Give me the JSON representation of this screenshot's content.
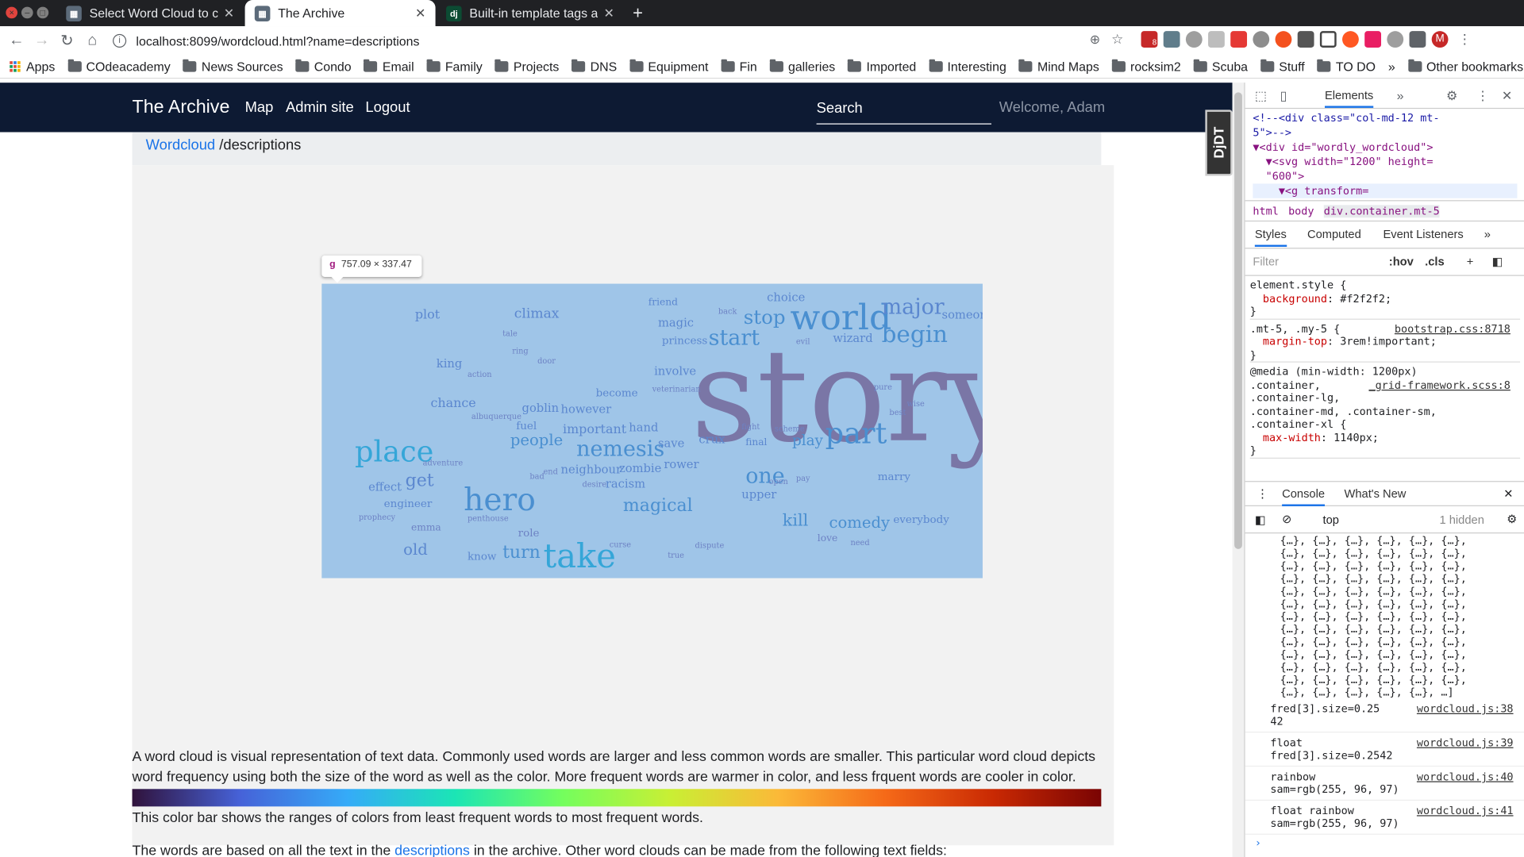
{
  "browser": {
    "tabs": [
      {
        "title": "Select Word Cloud to cha",
        "active": false
      },
      {
        "title": "The Archive",
        "active": true
      },
      {
        "title": "Built-in template tags an",
        "active": false
      }
    ],
    "url": "localhost:8099/wordcloud.html?name=descriptions",
    "bookmarks": [
      "Apps",
      "COdeacademy",
      "News Sources",
      "Condo",
      "Email",
      "Family",
      "Projects",
      "DNS",
      "Equipment",
      "Fin",
      "galleries",
      "Imported",
      "Interesting",
      "Mind Maps",
      "rocksim2",
      "Scuba",
      "Stuff",
      "TO DO"
    ],
    "other_bookmarks": "Other bookmarks",
    "more_bookmarks": "»",
    "profile_initial": "M",
    "extension_badge": "8"
  },
  "site": {
    "brand": "The Archive",
    "nav": [
      "Map",
      "Admin site",
      "Logout"
    ],
    "search_placeholder": "Search",
    "welcome": "Welcome, Adam",
    "djdt": "DjDT"
  },
  "breadcrumb": {
    "link": "Wordcloud",
    "rest": " /descriptions"
  },
  "inspector_tooltip": {
    "tag": "g",
    "size": "757.09 × 337.47"
  },
  "cloud_words": [
    {
      "t": "story",
      "c": "#7a76a6"
    },
    {
      "t": "world",
      "c": "#4a8fd0"
    },
    {
      "t": "hero",
      "c": "#4a8fd0"
    },
    {
      "t": "take",
      "c": "#35a6d8"
    },
    {
      "t": "place",
      "c": "#35a6d8"
    },
    {
      "t": "nemesis",
      "c": "#4a8fd0"
    },
    {
      "t": "part",
      "c": "#4a8fd0"
    },
    {
      "t": "major",
      "c": "#5b87cf"
    },
    {
      "t": "begin",
      "c": "#4a8fd0"
    },
    {
      "t": "start",
      "c": "#4a8fd0"
    },
    {
      "t": "stop",
      "c": "#4a8fd0"
    },
    {
      "t": "one",
      "c": "#4a8fd0"
    },
    {
      "t": "magical",
      "c": "#4a8fd0"
    },
    {
      "t": "turn",
      "c": "#4a8fd0"
    },
    {
      "t": "people",
      "c": "#4a8fd0"
    },
    {
      "t": "comedy",
      "c": "#4a8fd0"
    },
    {
      "t": "kill",
      "c": "#4a8fd0"
    },
    {
      "t": "play",
      "c": "#4a8fd0"
    },
    {
      "t": "get",
      "c": "#5b87cf"
    },
    {
      "t": "old",
      "c": "#5b87cf"
    },
    {
      "t": "climax",
      "c": "#5b87cf"
    },
    {
      "t": "plot",
      "c": "#5b87cf"
    },
    {
      "t": "someone",
      "c": "#5b87cf"
    },
    {
      "t": "wizard",
      "c": "#5b87cf"
    },
    {
      "t": "choice",
      "c": "#5b87cf"
    },
    {
      "t": "magic",
      "c": "#5b87cf"
    },
    {
      "t": "princess",
      "c": "#5b87cf"
    },
    {
      "t": "friend",
      "c": "#5b87cf"
    },
    {
      "t": "king",
      "c": "#5b87cf"
    },
    {
      "t": "chance",
      "c": "#5b87cf"
    },
    {
      "t": "goblin",
      "c": "#5b87cf"
    },
    {
      "t": "however",
      "c": "#5b87cf"
    },
    {
      "t": "become",
      "c": "#5b87cf"
    },
    {
      "t": "involve",
      "c": "#5b87cf"
    },
    {
      "t": "important",
      "c": "#5b87cf"
    },
    {
      "t": "hand",
      "c": "#5b87cf"
    },
    {
      "t": "fuel",
      "c": "#5b87cf"
    },
    {
      "t": "save",
      "c": "#5b87cf"
    },
    {
      "t": "zombie",
      "c": "#5b87cf"
    },
    {
      "t": "crux",
      "c": "#5b87cf"
    },
    {
      "t": "final",
      "c": "#5b87cf"
    },
    {
      "t": "rower",
      "c": "#5b87cf"
    },
    {
      "t": "neighbour",
      "c": "#5b87cf"
    },
    {
      "t": "racism",
      "c": "#5b87cf"
    },
    {
      "t": "effect",
      "c": "#5b87cf"
    },
    {
      "t": "engineer",
      "c": "#5b87cf"
    },
    {
      "t": "emma",
      "c": "#6d82c4"
    },
    {
      "t": "know",
      "c": "#5b87cf"
    },
    {
      "t": "upper",
      "c": "#5b87cf"
    },
    {
      "t": "marry",
      "c": "#5b87cf"
    },
    {
      "t": "everybody",
      "c": "#5b87cf"
    },
    {
      "t": "role",
      "c": "#6d82c4"
    },
    {
      "t": "love",
      "c": "#6d82c4"
    },
    {
      "t": "prophecy",
      "c": "#6d82c4"
    },
    {
      "t": "best",
      "c": "#6d82c4"
    },
    {
      "t": "pure",
      "c": "#6d82c4"
    },
    {
      "t": "veterinarian",
      "c": "#6d82c4"
    },
    {
      "t": "action",
      "c": "#6d82c4"
    },
    {
      "t": "albuquerque",
      "c": "#6d82c4"
    },
    {
      "t": "penthouse",
      "c": "#6d82c4"
    },
    {
      "t": "back",
      "c": "#6d82c4"
    },
    {
      "t": "evil",
      "c": "#6d82c4"
    },
    {
      "t": "ring",
      "c": "#6d82c4"
    },
    {
      "t": "tale",
      "c": "#6d82c4"
    },
    {
      "t": "door",
      "c": "#6d82c4"
    },
    {
      "t": "wise",
      "c": "#6d82c4"
    },
    {
      "t": "adventure",
      "c": "#6d82c4"
    },
    {
      "t": "desire",
      "c": "#6d82c4"
    },
    {
      "t": "pay",
      "c": "#6d82c4"
    },
    {
      "t": "open",
      "c": "#6d82c4"
    },
    {
      "t": "dispute",
      "c": "#6d82c4"
    },
    {
      "t": "need",
      "c": "#6d82c4"
    },
    {
      "t": "end",
      "c": "#6d82c4"
    },
    {
      "t": "bad",
      "c": "#6d82c4"
    },
    {
      "t": "curse",
      "c": "#6d82c4"
    },
    {
      "t": "true",
      "c": "#6d82c4"
    },
    {
      "t": "scheme",
      "c": "#6d82c4"
    },
    {
      "t": "fight",
      "c": "#6d82c4"
    },
    {
      "t": "legal",
      "c": "#6d82c4"
    },
    {
      "t": "come",
      "c": "#6d82c4"
    }
  ],
  "description": "A word cloud is visual representation of text data. Commonly used words are larger and less common words are smaller. This particular word cloud depicts word frequency using both the size of the word as well as the color. More frequent words are warmer in color, and less frquent words are cooler in color.",
  "colorbar_caption": "This color bar shows the ranges of colors from least frequent words to most frequent words.",
  "more_text": {
    "before": "The words are based on all the text in the ",
    "link": "descriptions",
    "after": " in the archive. Other word clouds can be made from the following text fields:"
  },
  "devtools": {
    "tabs": [
      "Elements"
    ],
    "more": "»",
    "dom_lines": [
      {
        "text": "<!--<div class=\"col-md-12 mt-",
        "cls": "val"
      },
      {
        "text": "5\">-->",
        "cls": "val"
      },
      {
        "text": "▼<div id=\"wordly_wordcloud\">",
        "cls": "tag"
      },
      {
        "text": "  ▼<svg width=\"1200\" height=",
        "cls": "tag"
      },
      {
        "text": "  \"600\">",
        "cls": "tag"
      },
      {
        "text": "    ▼<g transform=",
        "cls": "tag"
      }
    ],
    "breadcrumbs": [
      "html",
      "body",
      "div.container.mt-5"
    ],
    "subtabs": [
      "Styles",
      "Computed",
      "Event Listeners"
    ],
    "filter": "Filter",
    "hov": ":hov",
    "cls": ".cls",
    "styles": [
      {
        "sel": "element.style {",
        "src": ""
      },
      {
        "prop": "background",
        "val": "#f2f2f2;"
      },
      {
        "sel": "}",
        "src": ""
      },
      {
        "sel": ".mt-5, .my-5 {",
        "src": "bootstrap.css:8718"
      },
      {
        "prop": "margin-top",
        "val": "3rem!important;"
      },
      {
        "sel": "}",
        "src": ""
      },
      {
        "sel": "@media (min-width: 1200px)",
        "src": ""
      },
      {
        "sel": ".container,",
        "src": "_grid-framework.scss:8"
      },
      {
        "sel": ".container-lg,",
        "src": ""
      },
      {
        "sel": ".container-md, .container-sm,",
        "src": ""
      },
      {
        "sel": ".container-xl {",
        "src": ""
      },
      {
        "prop": "max-width",
        "val": "1140px;"
      },
      {
        "sel": "}",
        "src": ""
      }
    ],
    "console_tabs": [
      "Console",
      "What's New"
    ],
    "context": "top",
    "hidden": "1 hidden",
    "object_rows": 13,
    "object_row_text": "{…}, {…}, {…}, {…}, {…}, {…},",
    "object_row_last": "{…}, {…}, {…}, {…}, {…}, …]",
    "logs": [
      {
        "msg": "fred[3].size=0.25\n42",
        "src": "wordcloud.js:38"
      },
      {
        "msg": "float\nfred[3].size=0.2542",
        "src": "wordcloud.js:39"
      },
      {
        "msg": "rainbow\nsam=rgb(255, 96, 97)",
        "src": "wordcloud.js:40"
      },
      {
        "msg": "float rainbow\nsam=rgb(255, 96, 97)",
        "src": "wordcloud.js:41"
      }
    ],
    "prompt": "›"
  }
}
